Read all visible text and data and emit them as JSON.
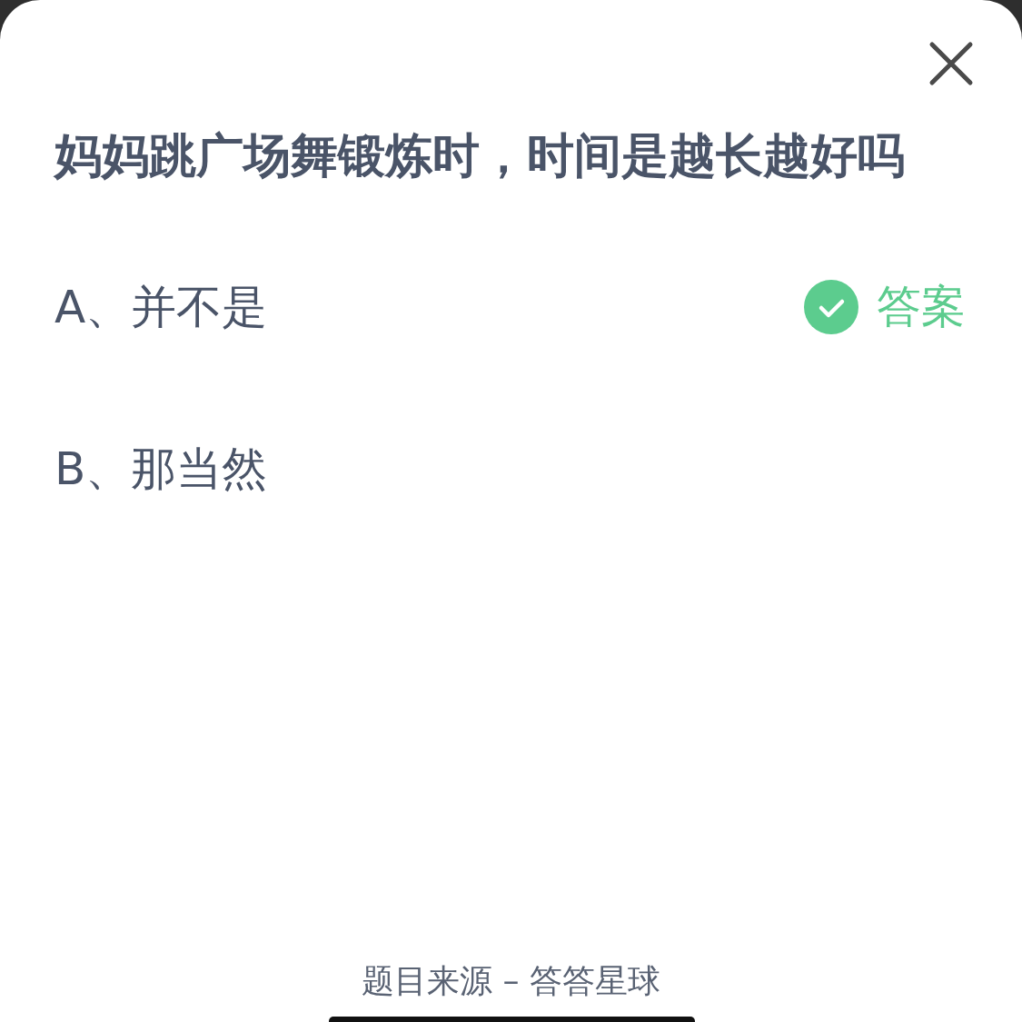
{
  "question": "妈妈跳广场舞锻炼时，时间是越长越好吗",
  "answer_badge": "答案",
  "options": [
    {
      "label": "A、并不是",
      "correct": true
    },
    {
      "label": "B、那当然",
      "correct": false
    }
  ],
  "footer": "题目来源 – 答答星球"
}
